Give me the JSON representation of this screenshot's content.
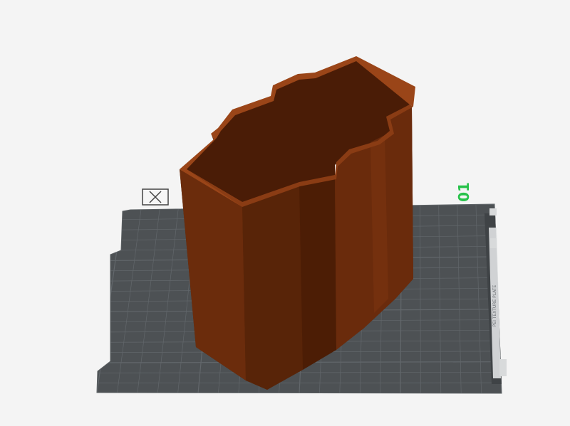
{
  "viewport": {
    "plate_number": "01",
    "bed_label": "PEI TEXTURE PLATE",
    "model_name": "",
    "delete_icon": "close-x-icon"
  },
  "colors": {
    "background": "#f4f4f4",
    "bed_surface": "#4d5154",
    "bed_grid": "#62676b",
    "bed_edge": "#e0e2e3",
    "plate_number": "#27c24a",
    "model_dark": "#3d1805",
    "model_mid": "#5e2608",
    "model_light": "#7c3410",
    "model_rim": "#9a4518"
  }
}
